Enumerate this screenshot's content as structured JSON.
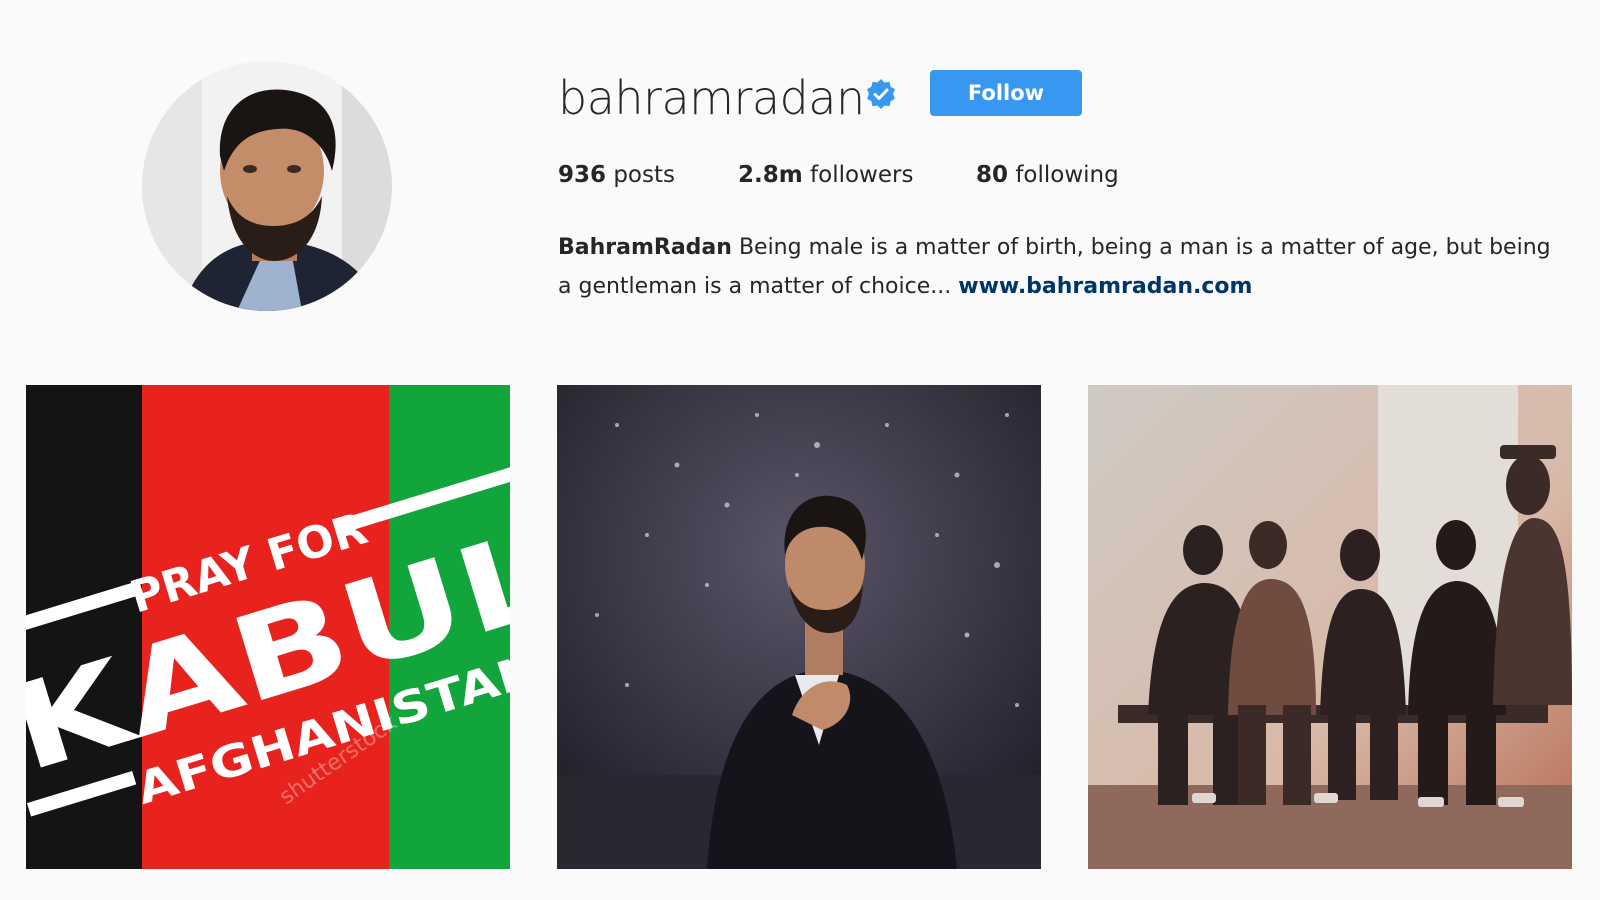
{
  "profile": {
    "username": "bahramradan",
    "verified": true,
    "follow_label": "Follow",
    "stats": {
      "posts_count": "936",
      "posts_label": "posts",
      "followers_count": "2.8m",
      "followers_label": "followers",
      "following_count": "80",
      "following_label": "following"
    },
    "bio": {
      "full_name": "BahramRadan",
      "text": "Being male is a matter of birth, being a man is a matter of age, but being a gentleman is a matter of choice...",
      "website": "www.bahramradan.com"
    }
  },
  "posts": [
    {
      "line1": "PRAY FOR",
      "line2": "KABUL",
      "line3": "AFGHANISTAN",
      "watermark": "shutterstock"
    },
    {},
    {}
  ],
  "colors": {
    "accent": "#3897f0",
    "link": "#003569",
    "flag_black": "#141414",
    "flag_red": "#e8221d",
    "flag_green": "#11a53b"
  }
}
